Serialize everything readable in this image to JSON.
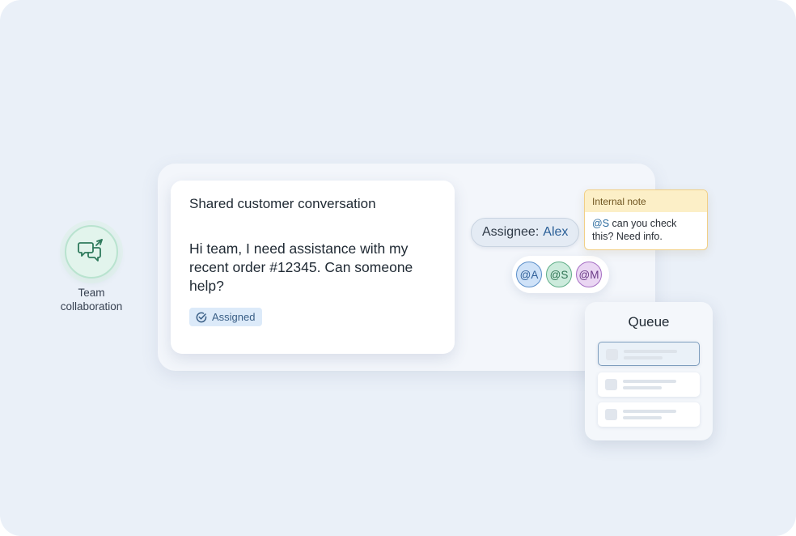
{
  "feature": {
    "icon": "chat-bubbles-arrow-icon",
    "label_line1": "Team",
    "label_line2": "collaboration",
    "color": "#2f7a5c"
  },
  "conversation": {
    "title": "Shared customer conversation",
    "message": "Hi team, I need assistance with my recent order #12345. Can someone help?",
    "badge_icon": "check-circle-icon",
    "badge_label": "Assigned"
  },
  "assignee": {
    "label": "Assignee:",
    "name": "Alex"
  },
  "mentions": [
    {
      "label": "@A",
      "color": "#5b8fca"
    },
    {
      "label": "@S",
      "color": "#5fae88"
    },
    {
      "label": "@M",
      "color": "#a66fc4"
    }
  ],
  "note": {
    "header": "Internal note",
    "mention": "@S",
    "text": " can you check this? Need info."
  },
  "queue": {
    "title": "Queue",
    "items": [
      {
        "state": "active"
      },
      {
        "state": "normal"
      },
      {
        "state": "normal"
      }
    ]
  }
}
